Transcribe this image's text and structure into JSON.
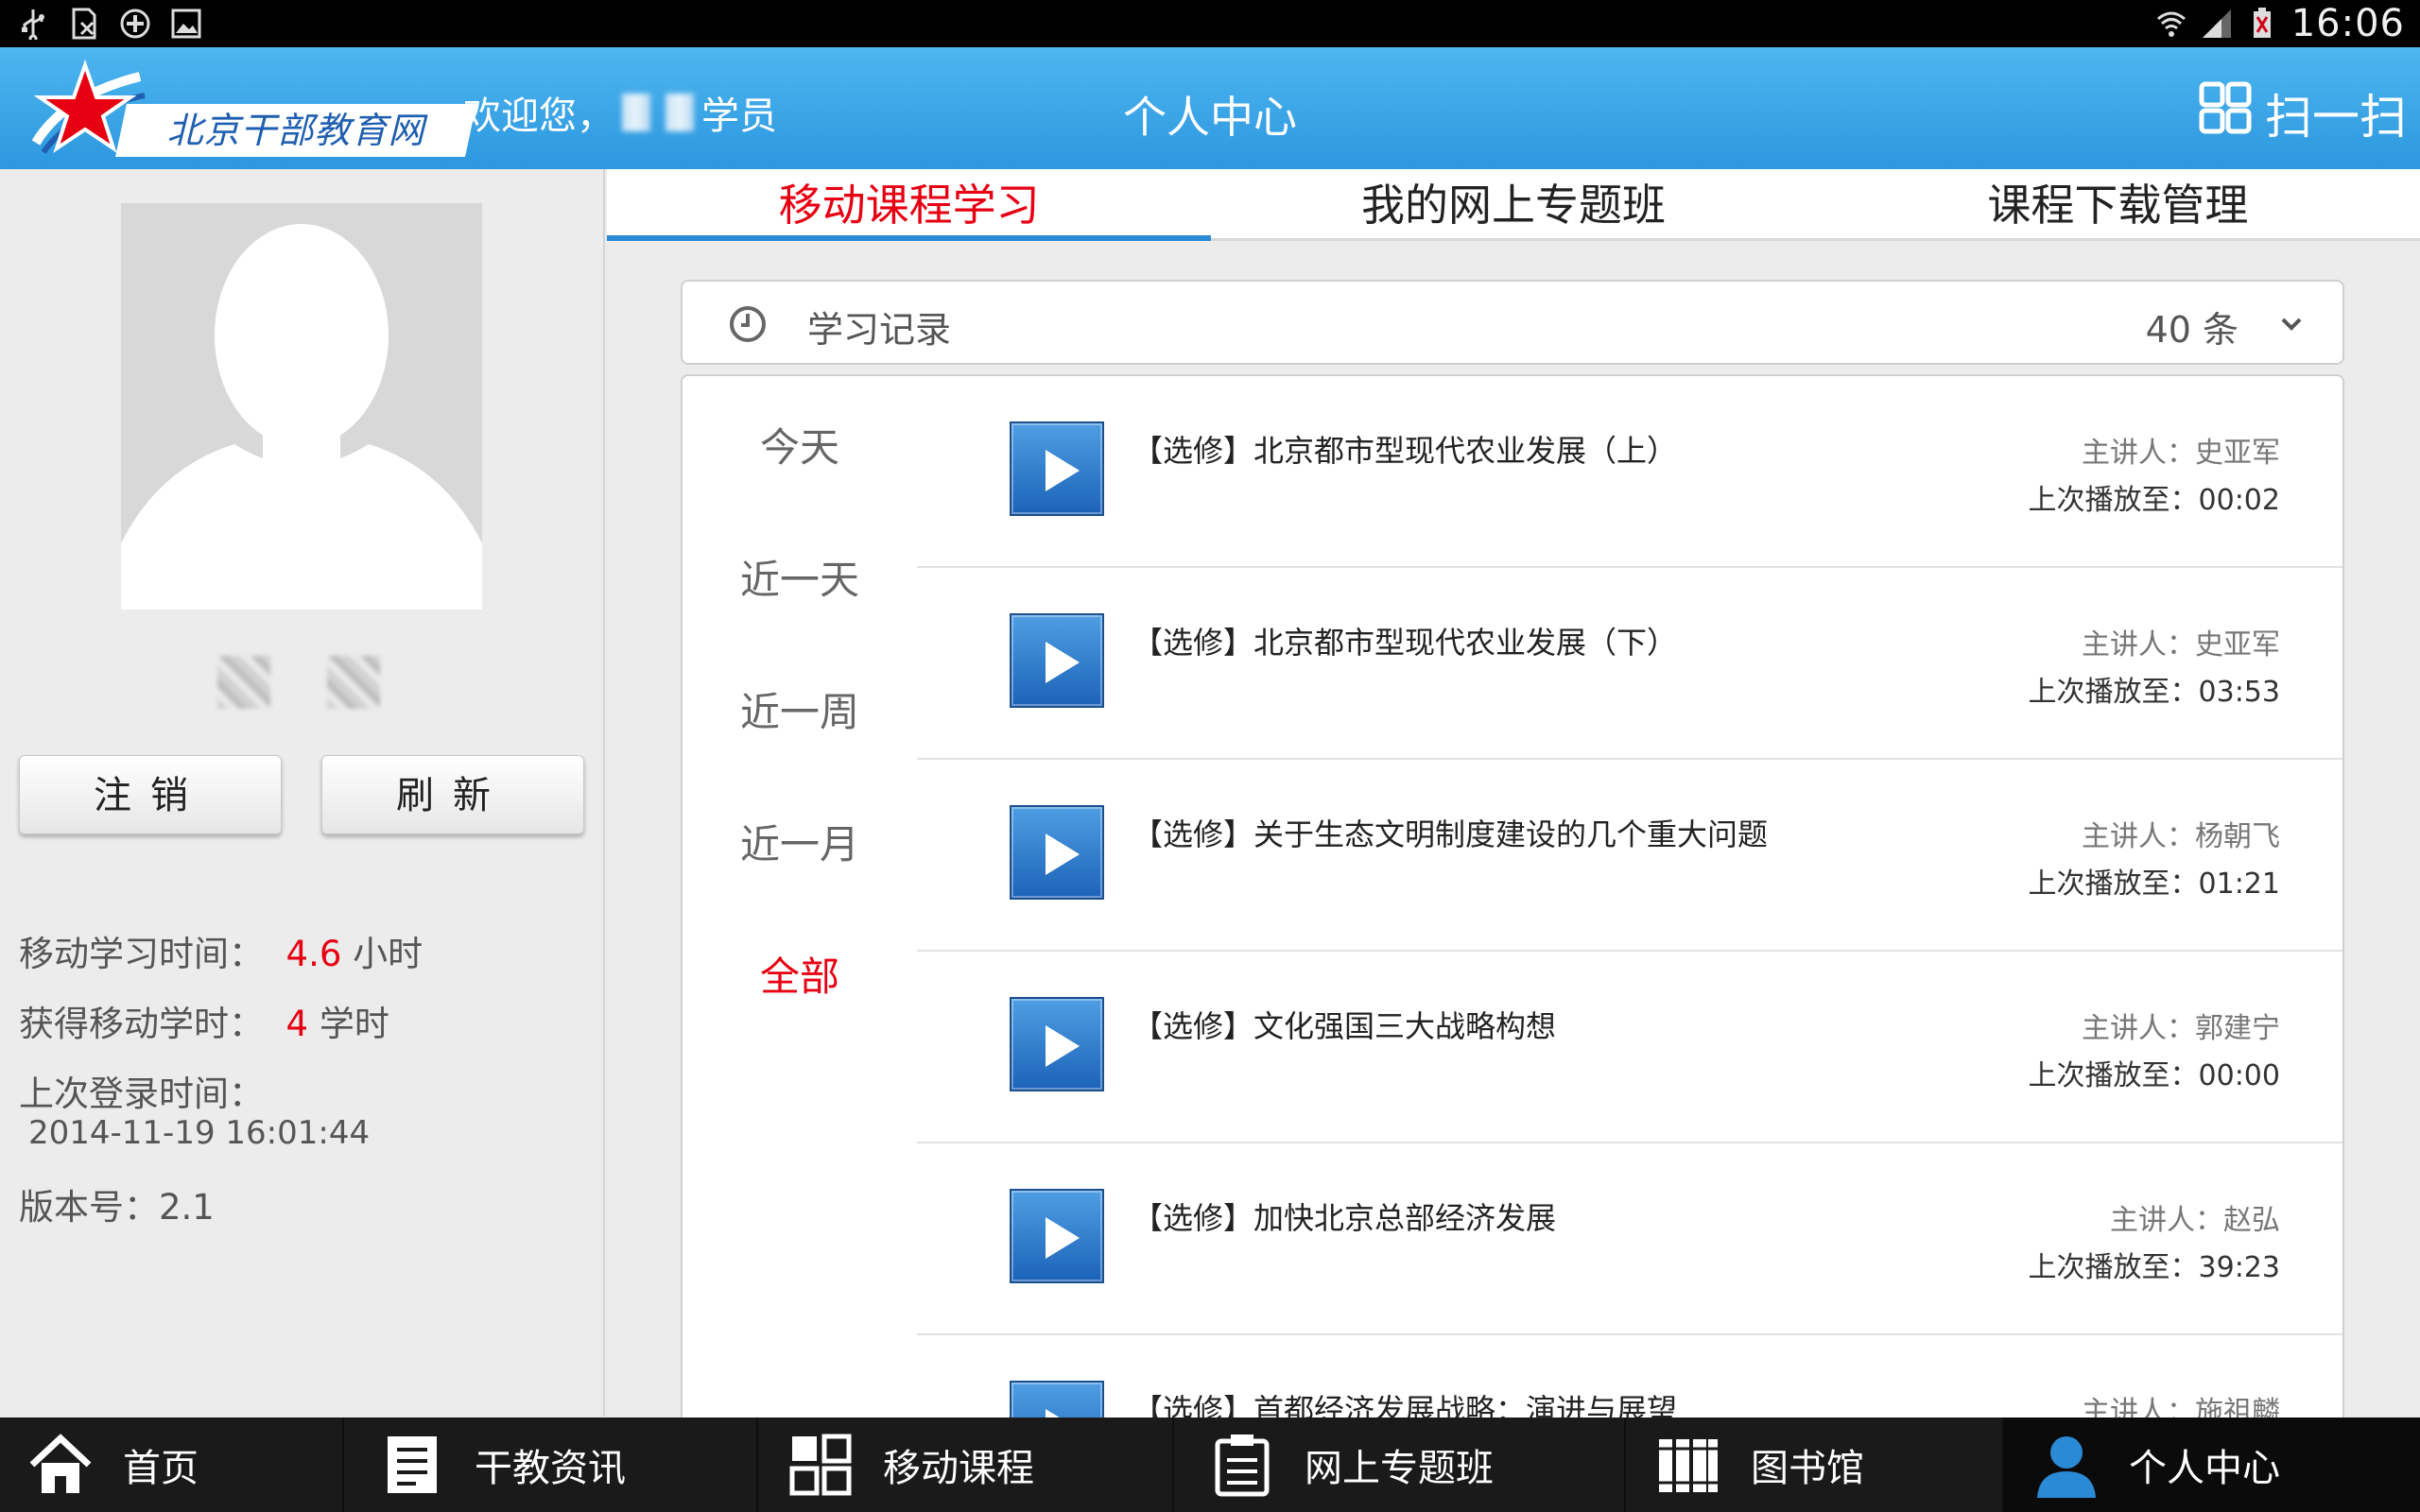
{
  "status_bar": {
    "time": "16:06"
  },
  "header": {
    "logo_text": "北京干部教育网",
    "welcome_prefix": "欢迎您，",
    "welcome_suffix": "学员",
    "title": "个人中心",
    "scan_label": "扫一扫",
    "accent_color": "#3aa6ea"
  },
  "left_panel": {
    "logout_label": "注销",
    "refresh_label": "刷新",
    "mobile_time_label": "移动学习时间：",
    "mobile_time_value": "4.6",
    "mobile_time_unit": "小时",
    "credits_label": "获得移动学时：",
    "credits_value": "4",
    "credits_unit": "学时",
    "last_login_label": "上次登录时间：",
    "last_login_value": "2014-11-19 16:01:44",
    "version_label": "版本号：2.1"
  },
  "tabs": [
    {
      "label": "移动课程学习",
      "active": true
    },
    {
      "label": "我的网上专题班",
      "active": false
    },
    {
      "label": "课程下载管理",
      "active": false
    }
  ],
  "record_bar": {
    "title": "学习记录",
    "count": "40 条"
  },
  "filters": [
    {
      "label": "今天",
      "active": false
    },
    {
      "label": "近一天",
      "active": false
    },
    {
      "label": "近一周",
      "active": false
    },
    {
      "label": "近一月",
      "active": false
    },
    {
      "label": "全部",
      "active": true
    }
  ],
  "courses": [
    {
      "title": "【选修】北京都市型现代农业发展（上）",
      "lecturer": "主讲人：史亚军",
      "progress": "上次播放至：00:02"
    },
    {
      "title": "【选修】北京都市型现代农业发展（下）",
      "lecturer": "主讲人：史亚军",
      "progress": "上次播放至：03:53"
    },
    {
      "title": "【选修】关于生态文明制度建设的几个重大问题",
      "lecturer": "主讲人：杨朝飞",
      "progress": "上次播放至：01:21"
    },
    {
      "title": "【选修】文化强国三大战略构想",
      "lecturer": "主讲人：郭建宁",
      "progress": "上次播放至：00:00"
    },
    {
      "title": "【选修】加快北京总部经济发展",
      "lecturer": "主讲人：赵弘",
      "progress": "上次播放至：39:23"
    },
    {
      "title": "【选修】首都经济发展战略：演进与展望",
      "lecturer": "主讲人：施祖麟",
      "progress": ""
    }
  ],
  "bottom_nav": [
    {
      "label": "首页",
      "icon": "home-icon",
      "active": false
    },
    {
      "label": "干教资讯",
      "icon": "news-icon",
      "active": false
    },
    {
      "label": "移动课程",
      "icon": "grid-icon",
      "active": false
    },
    {
      "label": "网上专题班",
      "icon": "clipboard-icon",
      "active": false
    },
    {
      "label": "图书馆",
      "icon": "books-icon",
      "active": false
    },
    {
      "label": "个人中心",
      "icon": "user-icon",
      "active": true
    }
  ],
  "colors": {
    "active_red": "#e60012",
    "play_blue": "#2a75c8"
  }
}
